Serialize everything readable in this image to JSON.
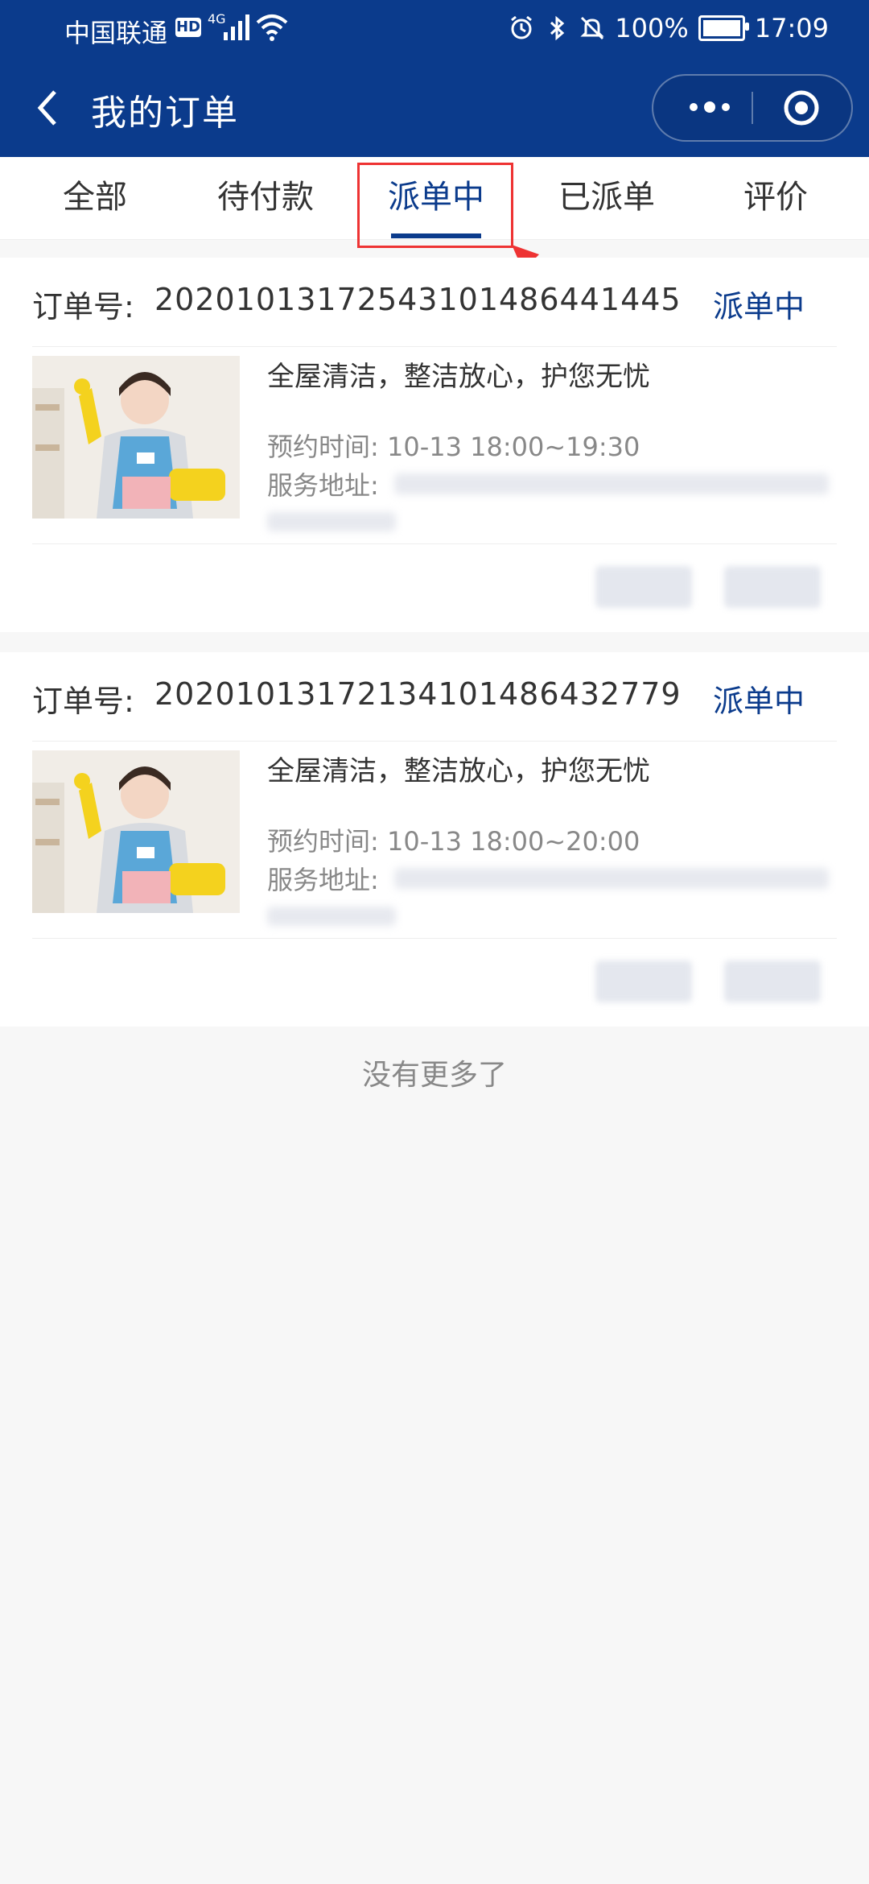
{
  "status_bar": {
    "carrier": "中国联通",
    "hd": "HD",
    "network": "4G",
    "battery": "100%",
    "time": "17:09",
    "icons": [
      "alarm-icon",
      "bluetooth-icon",
      "mute-icon",
      "battery-icon",
      "signal-icon",
      "wifi-icon"
    ]
  },
  "nav": {
    "title": "我的订单"
  },
  "tabs": [
    {
      "label": "全部"
    },
    {
      "label": "待付款"
    },
    {
      "label": "派单中",
      "active": true
    },
    {
      "label": "已派单"
    },
    {
      "label": "评价"
    }
  ],
  "orders": [
    {
      "no_label": "订单号:",
      "no": "20201013172543101486441445",
      "status": "派单中",
      "service": "全屋清洁，整洁放心，护您无忧",
      "booking_label": "预约时间:",
      "booking": "10-13 18:00~19:30",
      "address_label": "服务地址:"
    },
    {
      "no_label": "订单号:",
      "no": "20201013172134101486432779",
      "status": "派单中",
      "service": "全屋清洁，整洁放心，护您无忧",
      "booking_label": "预约时间:",
      "booking": "10-13 18:00~20:00",
      "address_label": "服务地址:"
    }
  ],
  "footer": {
    "no_more": "没有更多了"
  },
  "colors": {
    "brand": "#0b3b8c",
    "annotation": "#e33333"
  }
}
